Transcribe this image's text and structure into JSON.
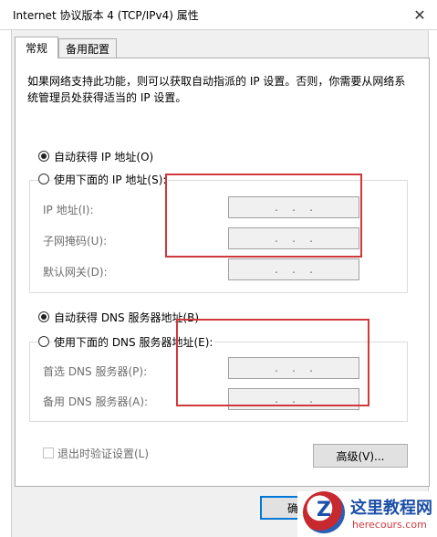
{
  "window": {
    "title": "Internet 协议版本 4 (TCP/IPv4) 属性",
    "close_glyph": "✕"
  },
  "tabs": [
    {
      "label": "常规",
      "active": true
    },
    {
      "label": "备用配置",
      "active": false
    }
  ],
  "description": "如果网络支持此功能，则可以获取自动指派的 IP 设置。否则，你需要从网络系统管理员处获得适当的 IP 设置。",
  "ip_section": {
    "auto_label": "自动获得 IP 地址(O)",
    "manual_label": "使用下面的 IP 地址(S):",
    "auto_selected": true,
    "fields": [
      {
        "label": "IP 地址(I):",
        "value": ".    .    ."
      },
      {
        "label": "子网掩码(U):",
        "value": ".    .    ."
      },
      {
        "label": "默认网关(D):",
        "value": ".    .    ."
      }
    ]
  },
  "dns_section": {
    "auto_label": "自动获得 DNS 服务器地址(B)",
    "manual_label": "使用下面的 DNS 服务器地址(E):",
    "auto_selected": true,
    "fields": [
      {
        "label": "首选 DNS 服务器(P):",
        "value": ".    .    ."
      },
      {
        "label": "备用 DNS 服务器(A):",
        "value": ".    .    ."
      }
    ]
  },
  "validate_label": "退出时验证设置(L)",
  "advanced_label": "高级(V)...",
  "ok_label": "确定",
  "watermark": {
    "logo_letter": "Z",
    "cn": "这里教程网",
    "en": "herecours.com"
  },
  "colors": {
    "accent": "#0078d7",
    "highlight_box": "#d0383d"
  }
}
